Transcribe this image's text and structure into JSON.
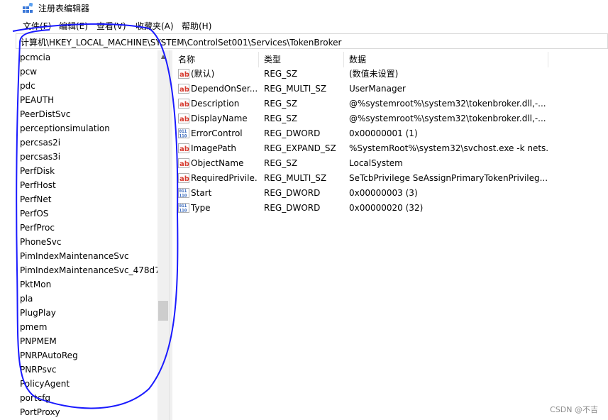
{
  "window": {
    "title": "注册表编辑器"
  },
  "menu": [
    {
      "label": "文件(F)"
    },
    {
      "label": "编辑(E)"
    },
    {
      "label": "查看(V)"
    },
    {
      "label": "收藏夹(A)"
    },
    {
      "label": "帮助(H)"
    }
  ],
  "address": {
    "path": "计算机\\HKEY_LOCAL_MACHINE\\SYSTEM\\ControlSet001\\Services\\TokenBroker"
  },
  "tree": {
    "items": [
      "pcmcia",
      "pcw",
      "pdc",
      "PEAUTH",
      "PeerDistSvc",
      "perceptionsimulation",
      "percsas2i",
      "percsas3i",
      "PerfDisk",
      "PerfHost",
      "PerfNet",
      "PerfOS",
      "PerfProc",
      "PhoneSvc",
      "PimIndexMaintenanceSvc",
      "PimIndexMaintenanceSvc_478d7",
      "PktMon",
      "pla",
      "PlugPlay",
      "pmem",
      "PNPMEM",
      "PNRPAutoReg",
      "PNRPsvc",
      "PolicyAgent",
      "portcfg",
      "PortProxy"
    ]
  },
  "list": {
    "headers": {
      "name": "名称",
      "type": "类型",
      "data": "数据"
    },
    "rows": [
      {
        "icon": "string-value-icon",
        "name": "(默认)",
        "type": "REG_SZ",
        "data": "(数值未设置)"
      },
      {
        "icon": "string-value-icon",
        "name": "DependOnSer...",
        "type": "REG_MULTI_SZ",
        "data": "UserManager"
      },
      {
        "icon": "string-value-icon",
        "name": "Description",
        "type": "REG_SZ",
        "data": "@%systemroot%\\system32\\tokenbroker.dll,-..."
      },
      {
        "icon": "string-value-icon",
        "name": "DisplayName",
        "type": "REG_SZ",
        "data": "@%systemroot%\\system32\\tokenbroker.dll,-..."
      },
      {
        "icon": "binary-value-icon",
        "name": "ErrorControl",
        "type": "REG_DWORD",
        "data": "0x00000001 (1)"
      },
      {
        "icon": "string-value-icon",
        "name": "ImagePath",
        "type": "REG_EXPAND_SZ",
        "data": "%SystemRoot%\\system32\\svchost.exe -k nets..."
      },
      {
        "icon": "string-value-icon",
        "name": "ObjectName",
        "type": "REG_SZ",
        "data": "LocalSystem"
      },
      {
        "icon": "string-value-icon",
        "name": "RequiredPrivile...",
        "type": "REG_MULTI_SZ",
        "data": "SeTcbPrivilege SeAssignPrimaryTokenPrivileg..."
      },
      {
        "icon": "binary-value-icon",
        "name": "Start",
        "type": "REG_DWORD",
        "data": "0x00000003 (3)"
      },
      {
        "icon": "binary-value-icon",
        "name": "Type",
        "type": "REG_DWORD",
        "data": "0x00000020 (32)"
      }
    ]
  },
  "watermark": {
    "text": "CSDN @不吉"
  },
  "colors": {
    "annotation_stroke": "#1a1aff",
    "string_icon_red": "#d63b2f",
    "binary_icon_blue": "#2b5fb8"
  }
}
